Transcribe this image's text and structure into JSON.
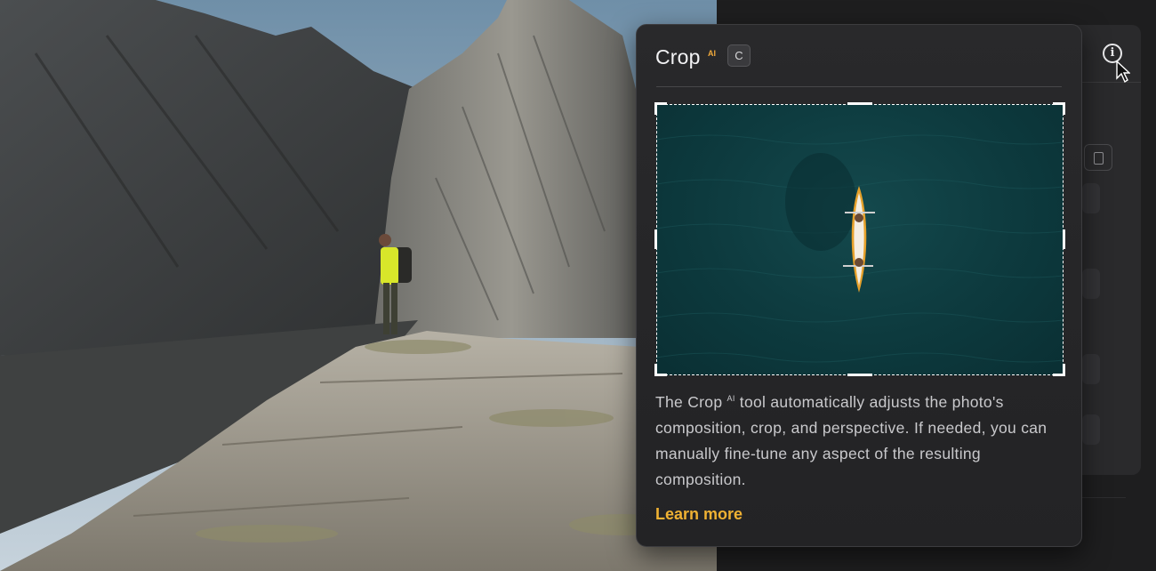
{
  "popover": {
    "title": "Crop",
    "title_badge": "AI",
    "shortcut_key": "C",
    "body_lead": "The Crop",
    "body_badge": "AI",
    "body_rest": " tool automatically adjusts the photo's composition, crop, and perspective. If needed, you can manually fine-tune any aspect of the resulting composition.",
    "learn_more_label": "Learn more"
  },
  "panel": {
    "info_icon_glyph": "i"
  },
  "colors": {
    "accent": "#f0b233",
    "badge": "#f0a93b",
    "popover_bg": "#29292b",
    "panel_bg": "#1e1e1f",
    "water": "#0d3a3e"
  },
  "icons": [
    "info-icon",
    "cursor-arrow-icon",
    "aspect-ratio-icon"
  ]
}
